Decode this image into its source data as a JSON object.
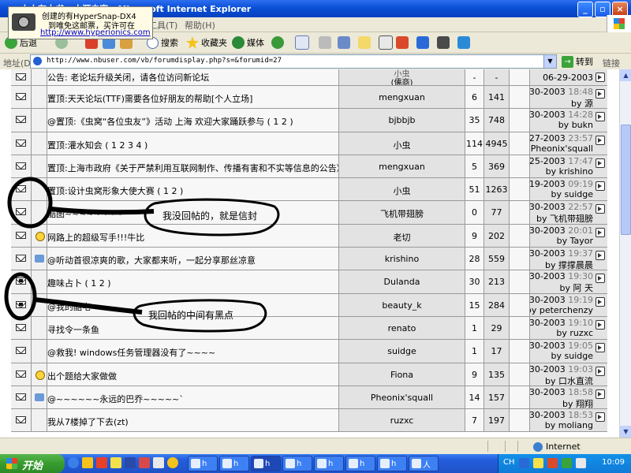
{
  "window": {
    "title": "人人有本书 - 水源虫窝 - Microsoft Internet Explorer",
    "buttons": [
      "_",
      "▫",
      "×"
    ]
  },
  "hypersnap": {
    "line1": "创建的有HyperSnap-DX4",
    "line2": "到唯免这邮票，买许可在",
    "line3": "http://www.hyperionics.com"
  },
  "menu": {
    "tools": "工具(T)",
    "help": "帮助(H)"
  },
  "toolbar": {
    "back": "后退",
    "search": "搜索",
    "favorites": "收藏夹",
    "media": "媒体"
  },
  "address": {
    "label": "地址(D)",
    "url": "http://www.nbuser.com/vb/forumdisplay.php?s=&forumid=27",
    "go": "转到",
    "links": "链接"
  },
  "threads": [
    {
      "title": "公告: 老论坛升级关闭，请各位访问新论坛",
      "author": "小虫",
      "author_sub": "(儒商)",
      "replies": "-",
      "views": "-",
      "date": "06-29-2003",
      "time": "",
      "by": "",
      "icon": "env"
    },
    {
      "title": "置顶:天天论坛(TTF)需要各位好朋友的帮助[个人立场]",
      "author": "mengxuan",
      "replies": "6",
      "views": "141",
      "date": "06-30-2003",
      "time": "18:48",
      "by": "by 源",
      "icon": "env"
    },
    {
      "title": "@置顶:《虫窝“各位虫友”》活动 上海 欢迎大家踊跃参与 ( 1 2 )",
      "author": "bjbbjb",
      "replies": "35",
      "views": "748",
      "date": "06-30-2003",
      "time": "14:28",
      "by": "by bukn",
      "icon": "env"
    },
    {
      "title": "置顶:灌水知会 ( 1 2 3 4 )",
      "author": "小虫",
      "replies": "114",
      "views": "4945",
      "date": "06-27-2003",
      "time": "23:57",
      "by": "by Pheonix'squall",
      "icon": "env"
    },
    {
      "title": "置顶:上海市政府《关于严禁利用互联网制作、传播有害和不实等信息的公告》",
      "author": "mengxuan",
      "replies": "5",
      "views": "369",
      "date": "06-25-2003",
      "time": "17:47",
      "by": "by krishino",
      "icon": "env"
    },
    {
      "title": "置顶:设计虫窝形象大使大赛 ( 1 2 )",
      "author": "小虫",
      "replies": "51",
      "views": "1263",
      "date": "06-19-2003",
      "time": "09:19",
      "by": "by suidge",
      "icon": "env"
    },
    {
      "title": "酷图~~~~~~~~",
      "author": "飞机带翅膀",
      "replies": "0",
      "views": "77",
      "date": "06-30-2003",
      "time": "22:57",
      "by": "by 飞机带翅膀",
      "icon": "env"
    },
    {
      "title": "网路上的超级写手!!!牛比",
      "author": "老切",
      "replies": "9",
      "views": "202",
      "date": "06-30-2003",
      "time": "20:01",
      "by": "by Tayor",
      "icon": "env",
      "sub": "face"
    },
    {
      "title": "@听动首很凉爽的歌，大家都来听，一起分享那丝凉意",
      "author": "krishino",
      "replies": "28",
      "views": "559",
      "date": "06-30-2003",
      "time": "19:37",
      "by": "by 撑撑晨晨",
      "icon": "env",
      "sub": "poster"
    },
    {
      "title": "趣味占卜 ( 1 2 )",
      "author": "Dulanda",
      "replies": "30",
      "views": "213",
      "date": "06-30-2003",
      "time": "19:30",
      "by": "by 阿 天",
      "icon": "envdot"
    },
    {
      "title": "@我的酷宅",
      "author": "beauty_k",
      "replies": "15",
      "views": "284",
      "date": "06-30-2003",
      "time": "19:19",
      "by": "by peterchenzy",
      "icon": "envdot"
    },
    {
      "title": "寻找令一条鱼",
      "author": "renato",
      "replies": "1",
      "views": "29",
      "date": "06-30-2003",
      "time": "19:10",
      "by": "by ruzxc",
      "icon": "env"
    },
    {
      "title": "@救我! windows任务管理器没有了~~~~",
      "author": "suidge",
      "replies": "1",
      "views": "17",
      "date": "06-30-2003",
      "time": "19:05",
      "by": "by suidge",
      "icon": "env"
    },
    {
      "title": "出个题给大家做做",
      "author": "Fiona",
      "replies": "9",
      "views": "135",
      "date": "06-30-2003",
      "time": "19:03",
      "by": "by 口水直流",
      "icon": "env",
      "sub": "face"
    },
    {
      "title": "@~~~~~~永远的巴乔~~~~~`",
      "author": "Pheonix'squall",
      "replies": "14",
      "views": "157",
      "date": "06-30-2003",
      "time": "18:58",
      "by": "by 翔翔",
      "icon": "env",
      "sub": "poster"
    },
    {
      "title": "我从7楼掉了下去(zt)",
      "author": "ruzxc",
      "replies": "7",
      "views": "197",
      "date": "06-30-2003",
      "time": "18:53",
      "by": "by moliang",
      "icon": "env"
    }
  ],
  "annotations": {
    "callout1": "我没回帖的，就是信封",
    "callout2": "我回帖的中间有黑点"
  },
  "status": {
    "zone": "Internet"
  },
  "taskbar": {
    "start": "开始",
    "tasks": [
      "h",
      "h",
      "h",
      "h",
      "h",
      "h",
      "h",
      "人"
    ],
    "lang": "CH",
    "clock": "10:09"
  }
}
